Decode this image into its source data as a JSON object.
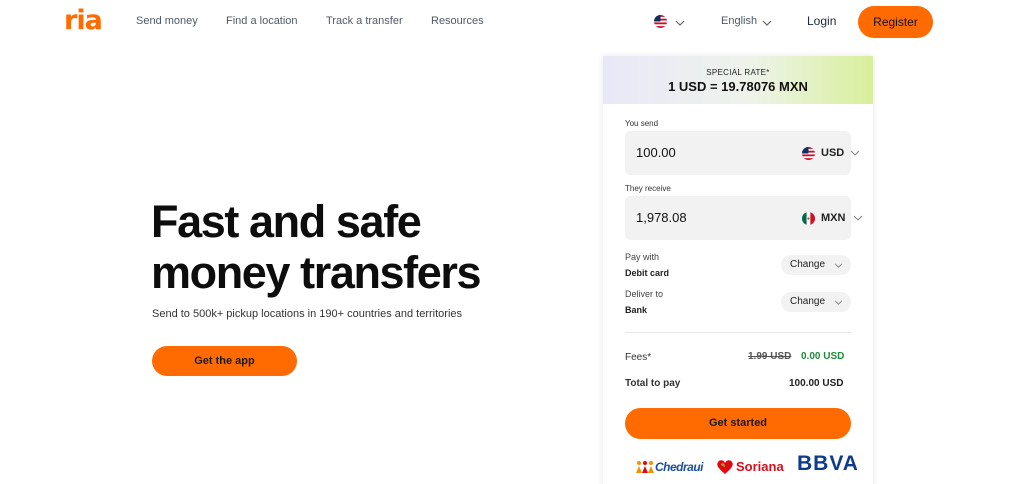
{
  "header": {
    "logo": "ria",
    "nav": [
      "Send money",
      "Find a location",
      "Track a transfer",
      "Resources"
    ],
    "language": "English",
    "login": "Login",
    "register": "Register"
  },
  "hero": {
    "title_line1": "Fast and safe",
    "title_line2": "money transfers",
    "subtitle": "Send to 500k+ pickup locations in 190+ countries and territories",
    "cta": "Get the app"
  },
  "calculator": {
    "rate_label": "SPECIAL RATE*",
    "rate_value": "1 USD = 19.78076 MXN",
    "send_label": "You send",
    "send_amount": "100.00",
    "send_currency": "USD",
    "receive_label": "They receive",
    "receive_amount": "1,978.08",
    "receive_currency": "MXN",
    "pay_with_label": "Pay with",
    "pay_with_value": "Debit card",
    "deliver_to_label": "Deliver to",
    "deliver_to_value": "Bank",
    "change_label": "Change",
    "fees_label": "Fees*",
    "fees_old": "1.99 USD",
    "fees_new": "0.00 USD",
    "total_label": "Total to pay",
    "total_value": "100.00 USD",
    "cta": "Get started"
  },
  "partners": [
    "Chedraui",
    "Soriana",
    "BBVA"
  ],
  "colors": {
    "brand": "#ff6b00",
    "fee_green": "#1f8a3a"
  }
}
